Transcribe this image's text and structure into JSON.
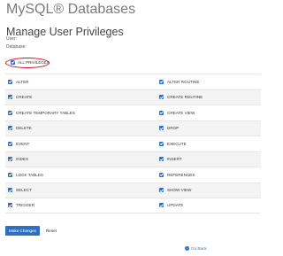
{
  "app": {
    "title": "MySQL® Databases"
  },
  "page": {
    "heading": "Manage User Privileges",
    "user_label": "User:",
    "database_label": "Database:"
  },
  "all_privileges": {
    "label": "ALL PRIVILEGES",
    "checked": true
  },
  "privileges": [
    {
      "left": "ALTER",
      "right": "ALTER ROUTINE"
    },
    {
      "left": "CREATE",
      "right": "CREATE ROUTINE"
    },
    {
      "left": "CREATE TEMPORARY TABLES",
      "right": "CREATE VIEW"
    },
    {
      "left": "DELETE",
      "right": "DROP"
    },
    {
      "left": "EVENT",
      "right": "EXECUTE"
    },
    {
      "left": "INDEX",
      "right": "INSERT"
    },
    {
      "left": "LOCK TABLES",
      "right": "REFERENCES"
    },
    {
      "left": "SELECT",
      "right": "SHOW VIEW"
    },
    {
      "left": "TRIGGER",
      "right": "UPDATE"
    }
  ],
  "actions": {
    "make_changes_label": "Make Changes",
    "reset_label": "Reset",
    "go_back_label": "Go Back"
  },
  "colors": {
    "accent": "#2f6fbf",
    "highlight_ring": "#d0102a"
  },
  "icons": {
    "checkbox": "checkbox-checked-icon",
    "go_back": "arrow-left-circle-icon"
  }
}
